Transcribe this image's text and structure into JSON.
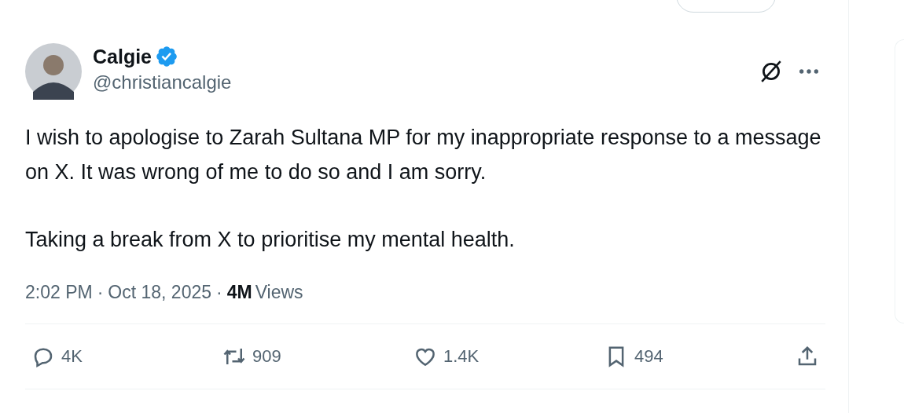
{
  "post": {
    "author": {
      "name": "Calgie",
      "verified": true,
      "handle": "@christiancalgie"
    },
    "paragraphs": [
      "I wish to apologise to Zarah Sultana MP for my inappropriate response to a message on X. It was wrong of me to do so and I am sorry.",
      "Taking a break from X to prioritise my mental health."
    ],
    "meta": {
      "time": "2:02 PM",
      "separator_1": "·",
      "date": "Oct 18, 2025",
      "separator_2": "·",
      "views_count": "4M",
      "views_label": "Views"
    },
    "actions": [
      {
        "kind": "reply",
        "count": "4K"
      },
      {
        "kind": "repost",
        "count": "909"
      },
      {
        "kind": "like",
        "count": "1.4K"
      },
      {
        "kind": "bookmark",
        "count": "494"
      },
      {
        "kind": "share"
      }
    ]
  }
}
